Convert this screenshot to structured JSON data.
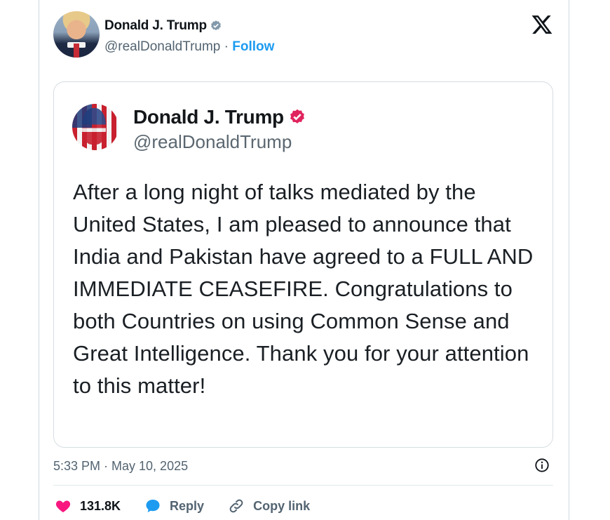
{
  "author": {
    "name": "Donald J. Trump",
    "handle": "@realDonaldTrump",
    "separator": " · ",
    "follow_label": "Follow"
  },
  "quoted_post": {
    "name": "Donald J. Trump",
    "handle": "@realDonaldTrump",
    "text": "After a long night of talks mediated by the United States, I am pleased to announce that India and Pakistan have agreed to a FULL AND IMMEDIATE CEASEFIRE. Congratulations to both Countries on using Common Sense and Great Intelligence. Thank you for your attention to this matter!"
  },
  "timestamp": "5:33 PM · May 10, 2025",
  "actions": {
    "likes": "131.8K",
    "reply_label": "Reply",
    "copy_link_label": "Copy link"
  },
  "icons": {
    "platform": "x-logo-icon",
    "verified_author": "verified-badge-gray-icon",
    "verified_quoted": "verified-badge-pink-icon",
    "info": "info-icon",
    "like": "heart-icon",
    "reply": "chat-bubble-icon",
    "copy": "link-icon"
  },
  "colors": {
    "accent": "#1d9bf0",
    "like": "#f91880",
    "reply": "#1d9bf0",
    "verified_gray": "#829aab",
    "verified_pink": "#e0245e",
    "muted_text": "#536471"
  }
}
